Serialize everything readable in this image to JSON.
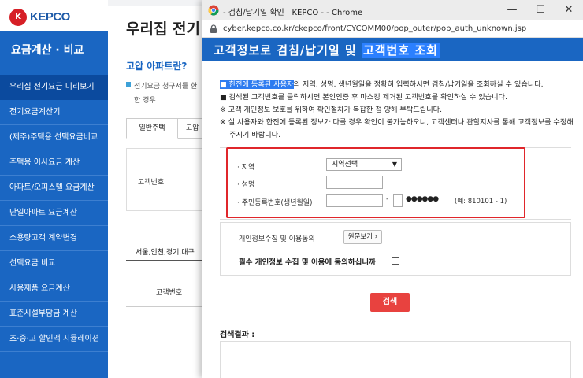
{
  "site": {
    "logo_text": "KEPCO",
    "logo_mark": "K",
    "sidebar_title": "요금계산 · 비교",
    "menu": [
      "우리집 전기요금 미리보기",
      "전기요금계산기",
      "(제주)주택용 선택요금비교",
      "주택용 이사요금 계산",
      "아파트/오피스텔 요금계산",
      "단일아파트 요금계산",
      "소용량고객 계약변경",
      "선택요금 비교",
      "사용제품 요금계산",
      "표준시설부담금 계산",
      "초·중·고 할인액 시뮬레이션"
    ],
    "page_heading": "우리집 전기",
    "sub_heading": "고압 아파트란?",
    "desc": "전기요금 청구서를 한 한 경우",
    "tab_general": "일반주택",
    "tab_hv": "고압",
    "bg_customer_label": "고객번호",
    "region_label": "서울,인천,경기,대구",
    "bg_table_head": "고객번호"
  },
  "popup": {
    "window_title": "- 검침/납기일 확인 | KEPCO - - Chrome",
    "url": "cyber.kepco.co.kr/ckepco/front/CYCOMM00/pop_outer/pop_auth_unknown.jsp",
    "header_prefix": "고객정보로 검침/납기일 및 ",
    "header_highlight": "고객번호 조회",
    "notice": {
      "line1_hl": "한전에 등록된 사용자",
      "line1_rest": "의 지역, 성명, 생년월일을 정확히 입력하시면 검침/납기일을 조회하실 수 있습니다.",
      "line2": "■ 검색된 고객번호를 클릭하시면 본인인증 후 마스킹 제거된 고객번호를 확인하실 수 있습니다.",
      "line3": "※ 고객 개인정보 보호를 위하여 확인절차가 복잡한 점 양해 부탁드립니다.",
      "line4": "※ 실 사용자와 한전에 등록된 정보가 다를 경우 확인이 불가능하오니, 고객센터나 관할지사를 통해 고객정보를 수정해주시기 바랍니다."
    },
    "form": {
      "region_label": "· 지역",
      "region_value": "지역선택",
      "name_label": "· 성명",
      "rrn_label": "· 주민등록번호(생년월일)",
      "dash": "-",
      "mask": "●●●●●●",
      "example": "(예: 810101 - 1)"
    },
    "consent": {
      "label": "개인정보수집 및 이용동의",
      "view_button": "원문보기 ›",
      "question": "필수 개인정보 수집 및 이용에 동의하십니까"
    },
    "search_button": "검색",
    "result_label": "검색결과 :"
  },
  "window_controls": {
    "minimize": "—",
    "maximize": "☐",
    "close": "✕"
  },
  "colors": {
    "brand_blue": "#1a66c2",
    "highlight_red": "#e0262b",
    "search_red": "#e8423f"
  },
  "icons": {
    "lock": "lock-icon",
    "chrome": "chrome-icon",
    "dropdown": "chevron-down-icon"
  }
}
